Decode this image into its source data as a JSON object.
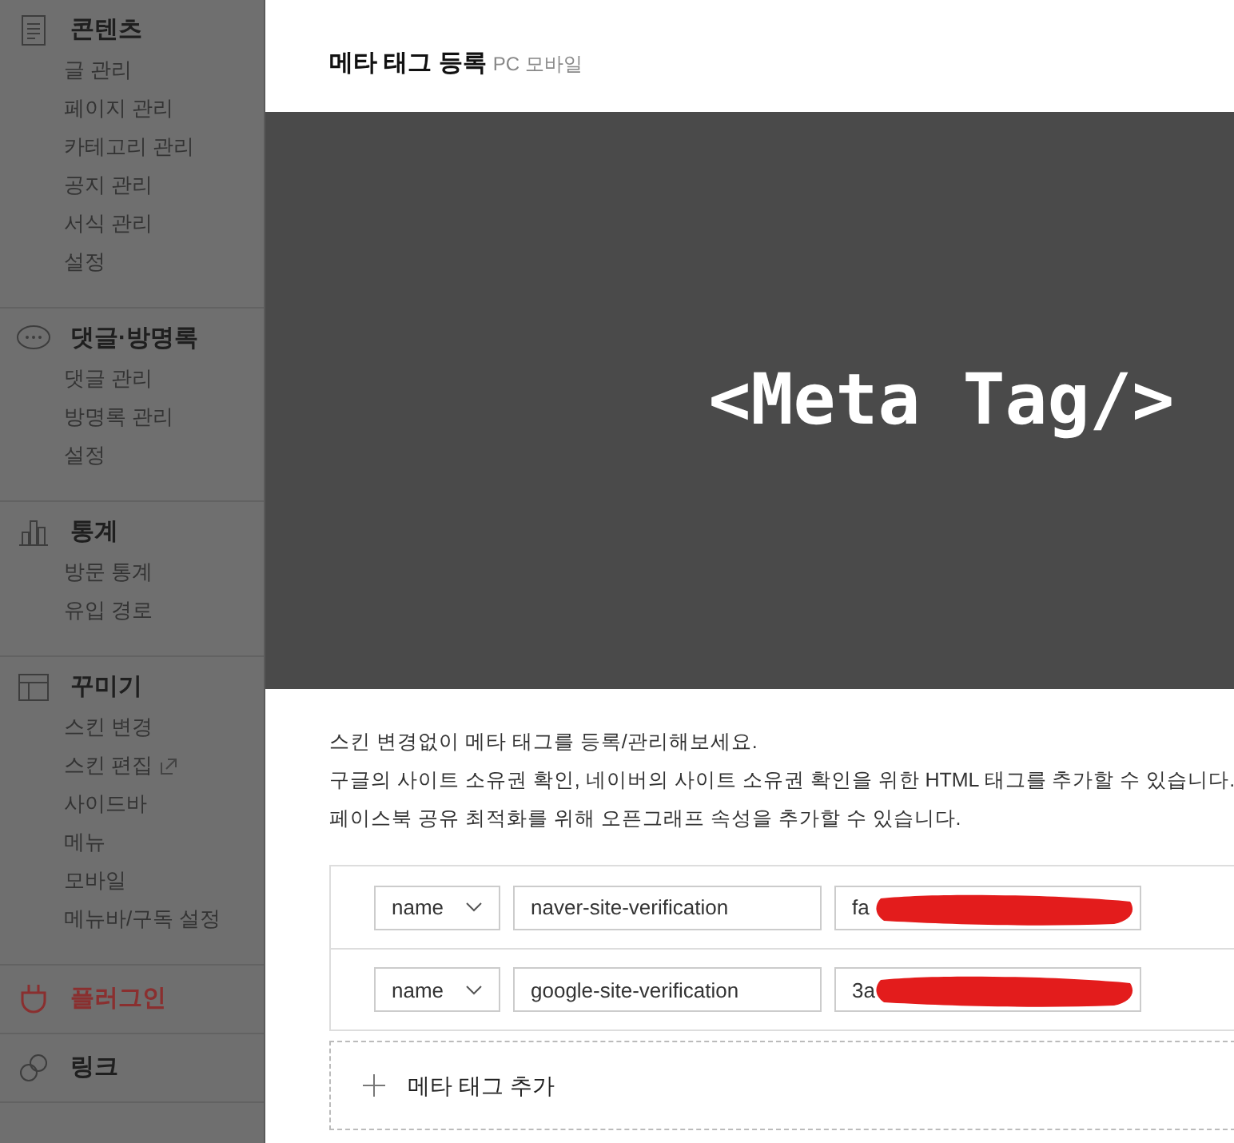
{
  "sidebar": {
    "sections": [
      {
        "kind": "document",
        "title": "콘텐츠",
        "selected": false,
        "items": [
          {
            "label": "글 관리"
          },
          {
            "label": "페이지 관리"
          },
          {
            "label": "카테고리 관리"
          },
          {
            "label": "공지 관리"
          },
          {
            "label": "서식 관리"
          },
          {
            "label": "설정"
          }
        ]
      },
      {
        "kind": "chat",
        "title": "댓글·방명록",
        "selected": false,
        "items": [
          {
            "label": "댓글 관리"
          },
          {
            "label": "방명록 관리"
          },
          {
            "label": "설정"
          }
        ]
      },
      {
        "kind": "chart",
        "title": "통계",
        "selected": false,
        "items": [
          {
            "label": "방문 통계"
          },
          {
            "label": "유입 경로"
          }
        ]
      },
      {
        "kind": "layout",
        "title": "꾸미기",
        "selected": false,
        "items": [
          {
            "label": "스킨 변경"
          },
          {
            "label": "스킨 편집",
            "external": true
          },
          {
            "label": "사이드바"
          },
          {
            "label": "메뉴"
          },
          {
            "label": "모바일"
          },
          {
            "label": "메뉴바/구독 설정"
          }
        ]
      },
      {
        "kind": "plug",
        "title": "플러그인",
        "selected": true
      },
      {
        "kind": "link",
        "title": "링크",
        "selected": false
      }
    ]
  },
  "dialog": {
    "title": "메타 태그 등록",
    "subtitle": "PC 모바일",
    "banner": "<Meta Tag/>",
    "description": [
      "스킨 변경없이 메타 태그를 등록/관리해보세요.",
      "구글의 사이트 소유권 확인, 네이버의 사이트 소유권 확인을 위한 HTML 태그를 추가할 수 있습니다.",
      "페이스북 공유 최적화를 위해 오픈그래프 속성을 추가할 수 있습니다."
    ],
    "tags": [
      {
        "attribute": "name",
        "key": "naver-site-verification",
        "value": "fa"
      },
      {
        "attribute": "name",
        "key": "google-site-verification",
        "value": "3a"
      }
    ],
    "add_button": "메타 태그 추가"
  }
}
